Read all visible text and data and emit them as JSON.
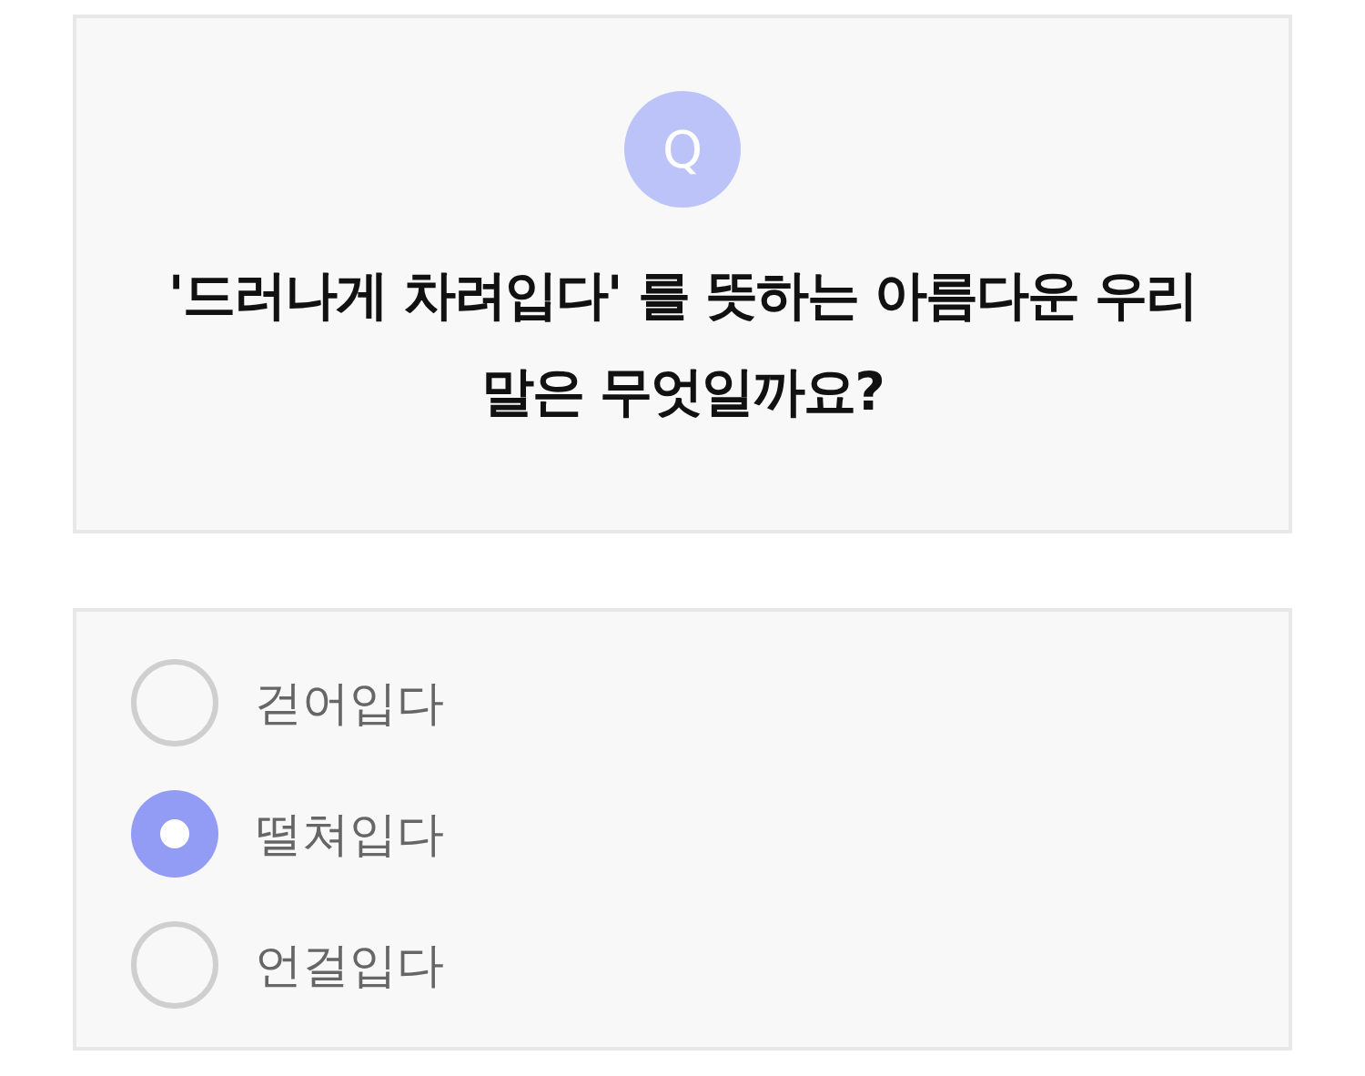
{
  "question": {
    "badge": "Q",
    "text": "'드러나게 차려입다' 를 뜻하는 아름다운 우리 말은 무엇일까요?"
  },
  "options": [
    {
      "label": "걷어입다",
      "selected": false
    },
    {
      "label": "떨쳐입다",
      "selected": true
    },
    {
      "label": "언걸입다",
      "selected": false
    }
  ]
}
